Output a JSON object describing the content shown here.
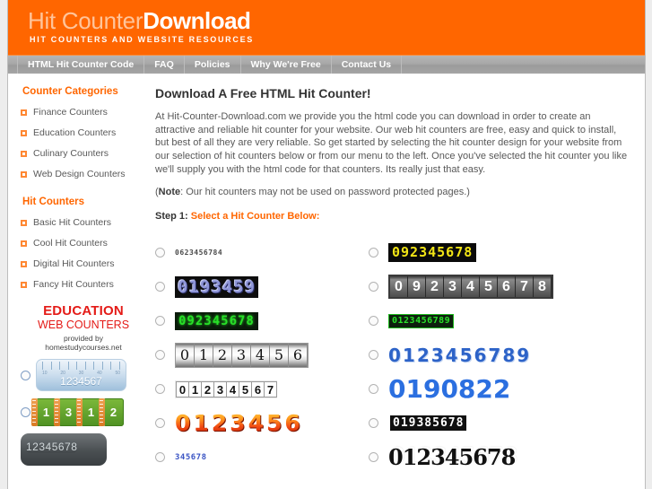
{
  "site": {
    "logo_light": "Hit Counter",
    "logo_bold": "Download",
    "tagline": "HIT COUNTERS AND WEBSITE RESOURCES",
    "brand_orange": "#ff6600",
    "nav_gray": "#a5a5a5"
  },
  "nav": {
    "items": [
      {
        "label": "HTML Hit Counter Code"
      },
      {
        "label": "FAQ"
      },
      {
        "label": "Policies"
      },
      {
        "label": "Why We're Free"
      },
      {
        "label": "Contact Us"
      }
    ]
  },
  "sidebar": {
    "section1_title": "Counter Categories",
    "section1_items": [
      {
        "label": "Finance Counters"
      },
      {
        "label": "Education Counters"
      },
      {
        "label": "Culinary Counters"
      },
      {
        "label": "Web Design Counters"
      }
    ],
    "section2_title": "Hit Counters",
    "section2_items": [
      {
        "label": "Basic Hit Counters"
      },
      {
        "label": "Cool Hit Counters"
      },
      {
        "label": "Digital Hit Counters"
      },
      {
        "label": "Fancy Hit Counters"
      }
    ],
    "ad": {
      "line1": "EDUCATION",
      "line2": "WEB COUNTERS",
      "line3": "provided by",
      "line4": "homestudycourses.net",
      "text_color": "#e41b17",
      "options": [
        {
          "style": "ruler",
          "value": "1234567",
          "ticks": [
            "10",
            "20",
            "30",
            "40",
            "50"
          ]
        },
        {
          "style": "books",
          "digits": [
            "1",
            "3",
            "1",
            "2"
          ]
        },
        {
          "style": "calculator",
          "value": "12345678"
        }
      ]
    }
  },
  "main": {
    "heading": "Download A Free HTML Hit Counter!",
    "intro": "At Hit-Counter-Download.com we provide you the html code you can download in order to create an attractive and reliable hit counter for your website. Our web hit counters are free, easy and quick to install, but best of all they are very reliable. So get started by selecting the hit counter design for your website from our selection of hit counters below or from our menu to the left. Once you've selected the hit counter you like we'll supply you with the html code for that counters. Its really just that easy.",
    "note_open": "(",
    "note_label": "Note",
    "note_body": ": Our hit counters may not be used on password protected pages.)",
    "step_label": "Step 1:",
    "step_text": "Select a Hit Counter Below:"
  },
  "counters": {
    "left_column": [
      {
        "style": "lcd-tiny",
        "value": "0623456784"
      },
      {
        "style": "blue-emboss",
        "value": "0193459"
      },
      {
        "style": "green-lcd",
        "value": "092345678"
      },
      {
        "style": "odometer",
        "value": "0123456"
      },
      {
        "style": "boxed",
        "value": "01234567"
      },
      {
        "style": "fire",
        "value": "0123456"
      },
      {
        "style": "blue-tiny",
        "value": "345678"
      }
    ],
    "right_column": [
      {
        "style": "yellow-lcd",
        "value": "092345678"
      },
      {
        "style": "odometer-white",
        "value": "092345678"
      },
      {
        "style": "green-small",
        "value": "0123456789"
      },
      {
        "style": "blue-pixel",
        "value": "0123456789"
      },
      {
        "style": "big-blue",
        "value": "0190822"
      },
      {
        "style": "segment-boxed",
        "value": "019385678"
      },
      {
        "style": "serif-shadow",
        "value": "012345678"
      }
    ]
  }
}
